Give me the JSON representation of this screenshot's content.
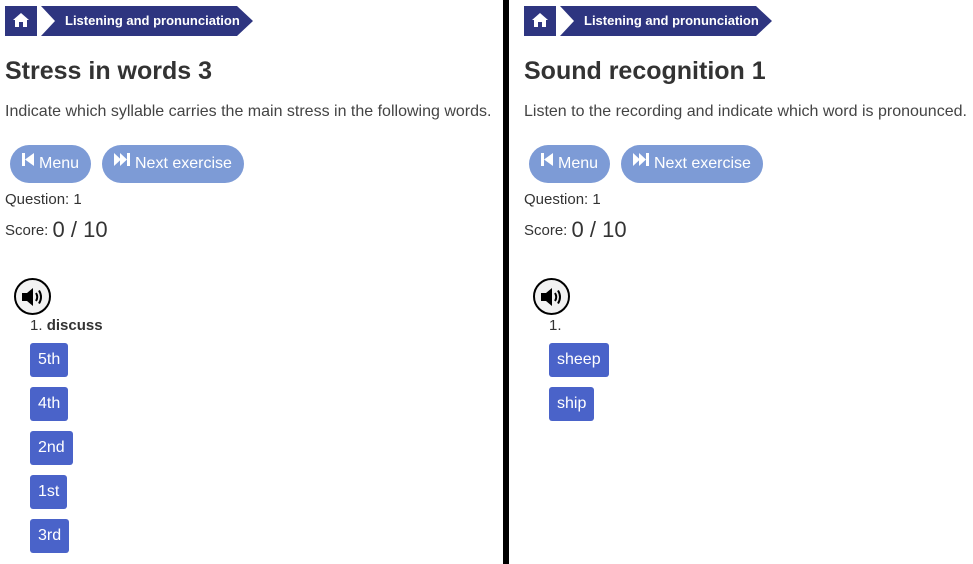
{
  "colors": {
    "breadcrumb": "#2e3580",
    "nav_button": "#7d9bd6",
    "answer_button": "#4a63c9",
    "divider": "#000000"
  },
  "panels": [
    {
      "breadcrumb": {
        "home_icon": "home-icon",
        "section": "Listening and pronunciation"
      },
      "title": "Stress in words 3",
      "instructions": "Indicate which syllable carries the main stress in the following words.",
      "menu_button": {
        "icon": "skip-back-icon",
        "label": "Menu"
      },
      "next_button": {
        "icon": "fast-forward-icon",
        "label": "Next exercise"
      },
      "question": "Question: 1",
      "score_label": "Score:",
      "score_value": "0 / 10",
      "audio_icon": "speaker-icon",
      "item_number": "1.",
      "item_word": "discuss",
      "options": [
        "5th",
        "4th",
        "2nd",
        "1st",
        "3rd"
      ]
    },
    {
      "breadcrumb": {
        "home_icon": "home-icon",
        "section": "Listening and pronunciation"
      },
      "title": "Sound recognition 1",
      "instructions": "Listen to the recording and indicate which word is pronounced.",
      "menu_button": {
        "icon": "skip-back-icon",
        "label": "Menu"
      },
      "next_button": {
        "icon": "fast-forward-icon",
        "label": "Next exercise"
      },
      "question": "Question: 1",
      "score_label": "Score:",
      "score_value": "0 / 10",
      "audio_icon": "speaker-icon",
      "item_number": "1.",
      "item_word": "",
      "options": [
        "sheep",
        "ship"
      ]
    }
  ]
}
